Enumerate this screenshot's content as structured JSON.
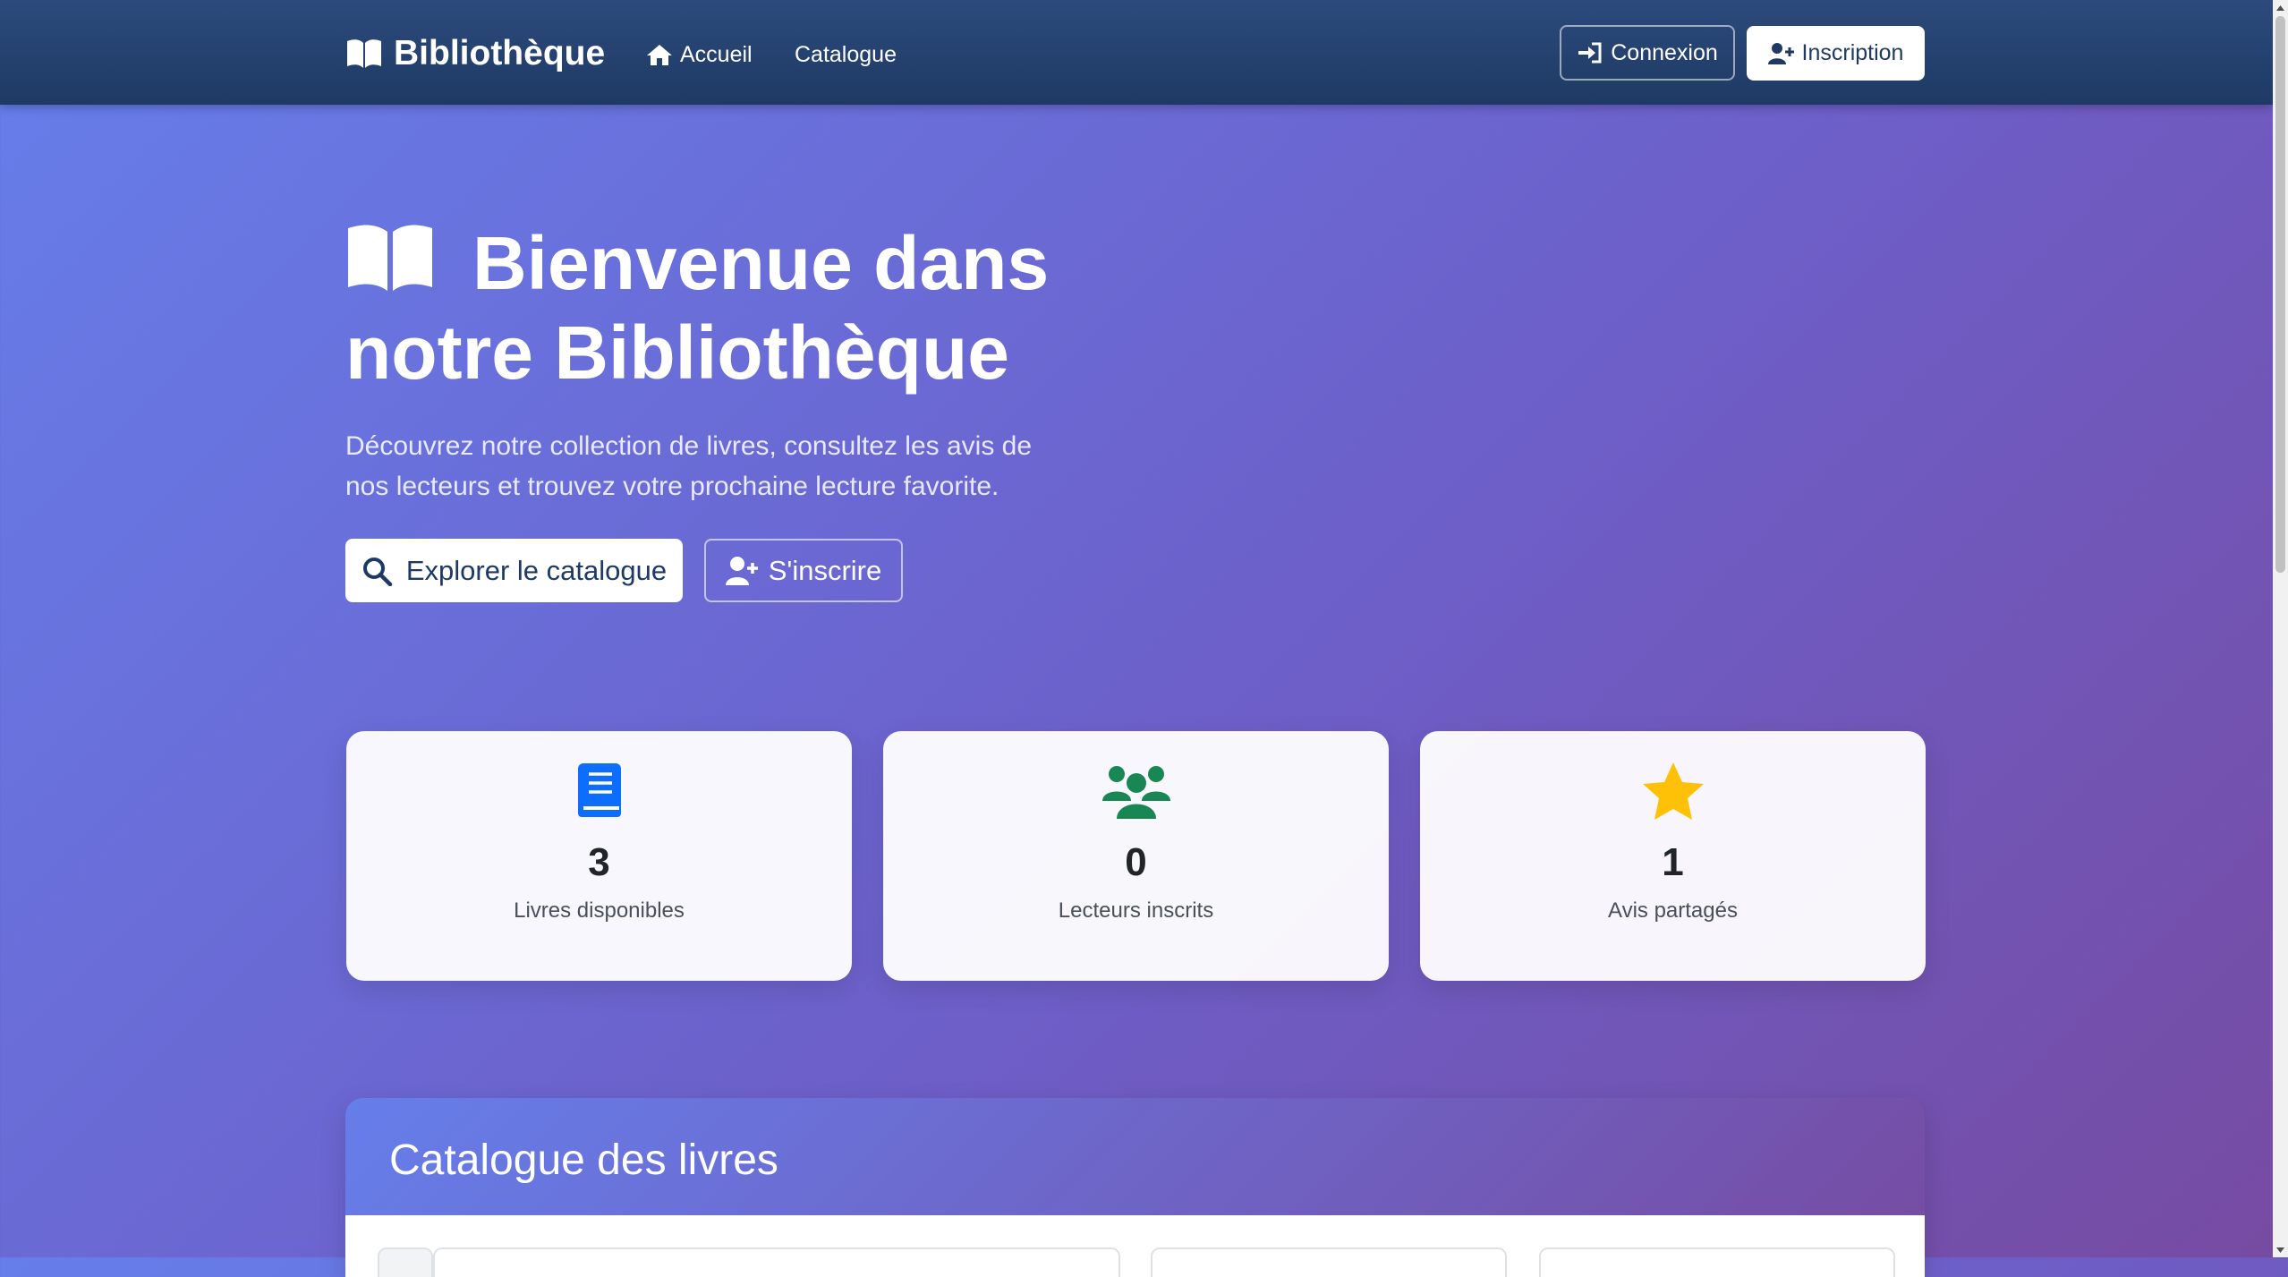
{
  "navbar": {
    "brand": "Bibliothèque",
    "links": [
      {
        "label": "Accueil",
        "icon": "home-icon"
      },
      {
        "label": "Catalogue"
      }
    ],
    "login_label": "Connexion",
    "register_label": "Inscription"
  },
  "hero": {
    "title": "Bienvenue dans notre Bibliothèque",
    "lead": "Découvrez notre collection de livres, consultez les avis de nos lecteurs et trouvez votre prochaine lecture favorite.",
    "explore_label": "Explorer le catalogue",
    "signup_label": "S'inscrire"
  },
  "stats": [
    {
      "icon": "book-icon",
      "value": "3",
      "label": "Livres disponibles",
      "color": "#0d6efd"
    },
    {
      "icon": "users-icon",
      "value": "0",
      "label": "Lecteurs inscrits",
      "color": "#198754"
    },
    {
      "icon": "star-icon",
      "value": "1",
      "label": "Avis partagés",
      "color": "#ffc107"
    }
  ],
  "catalogue": {
    "title": "Catalogue des livres"
  },
  "colors": {
    "navbar": "#1e3a64",
    "gradient_start": "#667eea",
    "gradient_end": "#764ba2"
  }
}
